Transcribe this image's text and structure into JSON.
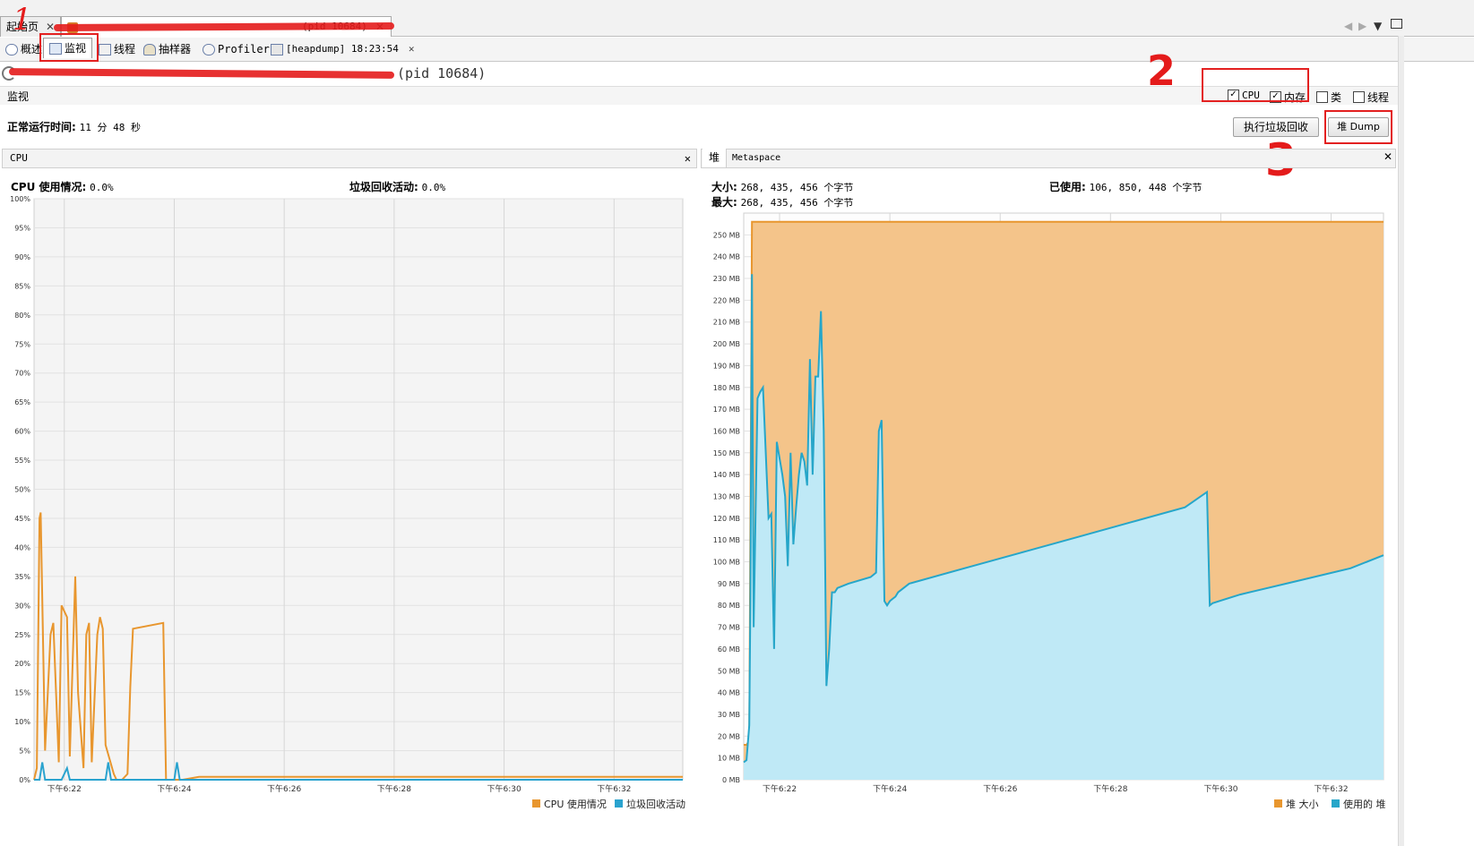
{
  "tabs": {
    "start_label": "起始页",
    "app_label": "(pid 10684)",
    "close": "✕"
  },
  "subtabs": {
    "overview": "概述",
    "monitor": "监视",
    "threads": "线程",
    "sampler": "抽样器",
    "profiler": "Profiler",
    "heapdump": "[heapdump] 18:23:54",
    "close": "✕"
  },
  "process_title": "(pid 10684)",
  "monitor_section": "监视",
  "checkboxes": {
    "cpu": "CPU",
    "memory": "内存",
    "classes": "类",
    "threads": "线程"
  },
  "uptime": {
    "label": "正常运行时间:",
    "value": "11 分 48 秒"
  },
  "buttons": {
    "gc": "执行垃圾回收",
    "heap_dump": "堆 Dump"
  },
  "annotations": {
    "n1": "1",
    "n2": "2",
    "n3": "3"
  },
  "cpu_panel": {
    "header": "CPU",
    "close": "✕",
    "usage_label": "CPU 使用情况:",
    "usage_value": "0.0%",
    "gc_label": "垃圾回收活动:",
    "gc_value": "0.0%",
    "legend_cpu": "CPU 使用情况",
    "legend_gc": "垃圾回收活动"
  },
  "heap_panel": {
    "tab_heap": "堆",
    "tab_metaspace": "Metaspace",
    "close": "✕",
    "size_label": "大小:",
    "size_value": "268, 435, 456 个字节",
    "max_label": "最大:",
    "max_value": "268, 435, 456 个字节",
    "used_label": "已使用:",
    "used_value": "106, 850, 448 个字节",
    "legend_size": "堆 大小",
    "legend_used": "使用的 堆"
  },
  "colors": {
    "cpu": "#e8962e",
    "gc": "#2aa3cf",
    "heap_size": "#f4c48a",
    "heap_used": "#bfe9f6",
    "annotation_red": "#e41b1b"
  },
  "chart_data": [
    {
      "type": "line",
      "title": "CPU",
      "x_ticks": [
        "下午6:22",
        "下午6:24",
        "下午6:26",
        "下午6:28",
        "下午6:30",
        "下午6:32"
      ],
      "y_ticks": [
        "0%",
        "5%",
        "10%",
        "15%",
        "20%",
        "25%",
        "30%",
        "35%",
        "40%",
        "45%",
        "50%",
        "55%",
        "60%",
        "65%",
        "70%",
        "75%",
        "80%",
        "85%",
        "90%",
        "95%",
        "100%"
      ],
      "ylim": [
        0,
        100
      ],
      "xlim_minutes": [
        0,
        11.8
      ],
      "series": [
        {
          "name": "CPU 使用情况",
          "x": [
            0,
            0.05,
            0.1,
            0.12,
            0.2,
            0.3,
            0.35,
            0.45,
            0.5,
            0.6,
            0.65,
            0.75,
            0.8,
            0.9,
            0.95,
            1.0,
            1.05,
            1.15,
            1.2,
            1.25,
            1.3,
            1.45,
            1.5,
            1.55,
            1.6,
            1.7,
            1.75,
            1.8,
            2.35,
            2.4,
            2.45,
            2.5,
            2.55,
            2.6,
            2.7,
            3.0,
            4.0,
            5.0,
            6.0,
            7.0,
            8.0,
            9.0,
            10.0,
            11.0,
            11.8
          ],
          "y": [
            0,
            2,
            45,
            46,
            5,
            25,
            27,
            3,
            30,
            28,
            4,
            35,
            15,
            2,
            25,
            27,
            3,
            25,
            28,
            26,
            6,
            1,
            0,
            0,
            0,
            1,
            16,
            26,
            27,
            0,
            0,
            0,
            0,
            0,
            0,
            0.5,
            0.5,
            0.5,
            0.5,
            0.5,
            0.5,
            0.5,
            0.5,
            0.5,
            0.5
          ]
        },
        {
          "name": "垃圾回收活动",
          "x": [
            0,
            0.1,
            0.15,
            0.2,
            0.5,
            0.6,
            0.65,
            1.3,
            1.35,
            1.4,
            2.55,
            2.6,
            2.65,
            11.8
          ],
          "y": [
            0,
            0,
            3,
            0,
            0,
            2,
            0,
            0,
            3,
            0,
            0,
            3,
            0,
            0
          ]
        }
      ]
    },
    {
      "type": "area",
      "title": "堆",
      "x_ticks": [
        "下午6:22",
        "下午6:24",
        "下午6:26",
        "下午6:28",
        "下午6:30",
        "下午6:32"
      ],
      "y_ticks": [
        "0 MB",
        "10 MB",
        "20 MB",
        "30 MB",
        "40 MB",
        "50 MB",
        "60 MB",
        "70 MB",
        "80 MB",
        "90 MB",
        "100 MB",
        "110 MB",
        "120 MB",
        "130 MB",
        "140 MB",
        "150 MB",
        "160 MB",
        "170 MB",
        "180 MB",
        "190 MB",
        "200 MB",
        "210 MB",
        "220 MB",
        "230 MB",
        "240 MB",
        "250 MB"
      ],
      "ylim": [
        0,
        260
      ],
      "xlim_minutes": [
        0,
        11.6
      ],
      "series": [
        {
          "name": "堆 大小",
          "x": [
            0,
            0.05,
            0.1,
            0.15,
            11.6
          ],
          "y": [
            16,
            16,
            18,
            256,
            256
          ]
        },
        {
          "name": "使用的 堆",
          "x": [
            0,
            0.05,
            0.1,
            0.12,
            0.15,
            0.18,
            0.25,
            0.3,
            0.35,
            0.45,
            0.5,
            0.55,
            0.6,
            0.7,
            0.75,
            0.8,
            0.85,
            0.9,
            0.95,
            1.0,
            1.05,
            1.1,
            1.15,
            1.2,
            1.25,
            1.3,
            1.35,
            1.4,
            1.45,
            1.5,
            1.55,
            1.6,
            1.65,
            1.7,
            1.9,
            2.3,
            2.4,
            2.45,
            2.5,
            2.55,
            2.6,
            2.65,
            2.7,
            2.75,
            2.8,
            3.0,
            4.0,
            5.0,
            6.0,
            7.0,
            8.0,
            8.4,
            8.45,
            8.5,
            9.0,
            10.0,
            11.0,
            11.6
          ],
          "y": [
            8,
            9,
            25,
            80,
            232,
            70,
            175,
            178,
            180,
            120,
            122,
            60,
            155,
            140,
            130,
            98,
            150,
            108,
            125,
            140,
            150,
            146,
            135,
            193,
            140,
            185,
            185,
            215,
            160,
            43,
            60,
            86,
            86,
            88,
            90,
            93,
            95,
            160,
            165,
            82,
            80,
            82,
            83,
            84,
            86,
            90,
            97,
            104,
            111,
            118,
            125,
            132,
            80,
            81,
            85,
            91,
            97,
            103
          ]
        }
      ]
    }
  ]
}
